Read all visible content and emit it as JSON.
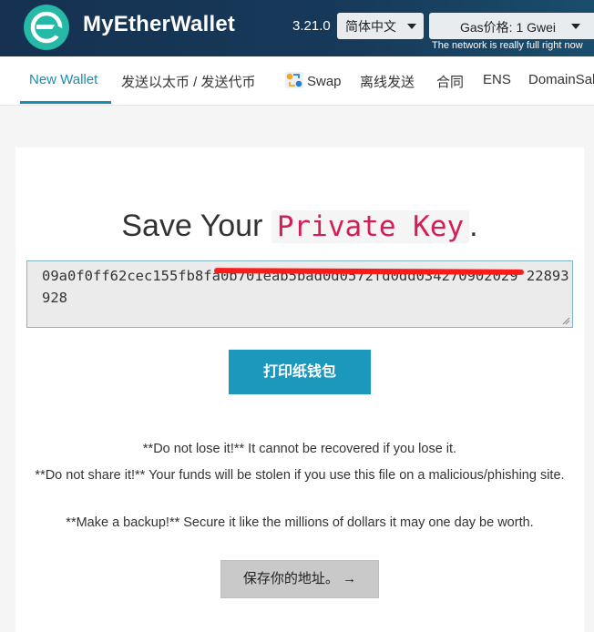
{
  "header": {
    "brand": "MyEtherWallet",
    "version": "3.21.0",
    "language": "简体中文",
    "gas_label": "Gas价格: 1 Gwei",
    "network_note": "The network is really full right now"
  },
  "nav": {
    "items": [
      {
        "label": "New Wallet",
        "active": true
      },
      {
        "label": "发送以太币 / 发送代币",
        "active": false
      },
      {
        "label": "Swap",
        "active": false,
        "icon": "swap-icon"
      },
      {
        "label": "离线发送",
        "active": false
      },
      {
        "label": "合同",
        "active": false
      },
      {
        "label": "ENS",
        "active": false
      },
      {
        "label": "DomainSale",
        "active": false
      }
    ]
  },
  "main": {
    "title_prefix": "Save Your",
    "title_code": "Private Key",
    "title_suffix": ".",
    "private_key": "09a0f0ff62cec155fb8fa0b701eab5bad0d0572fd0dd034270902029 22893928",
    "print_button": "打印纸钱包",
    "warnings": [
      "**Do not lose it!** It cannot be recovered if you lose it.",
      "**Do not share it!** Your funds will be stolen if you use this file on a malicious/phishing site.",
      "**Make a backup!** Secure it like the millions of dollars it may one day be worth."
    ],
    "next_button": "保存你的地址。 →"
  },
  "colors": {
    "header_bg": "#163151",
    "accent": "#1b8cb1",
    "button_primary": "#1b98bc",
    "code_text": "#d21f56",
    "redaction": "#ff1a1a"
  }
}
